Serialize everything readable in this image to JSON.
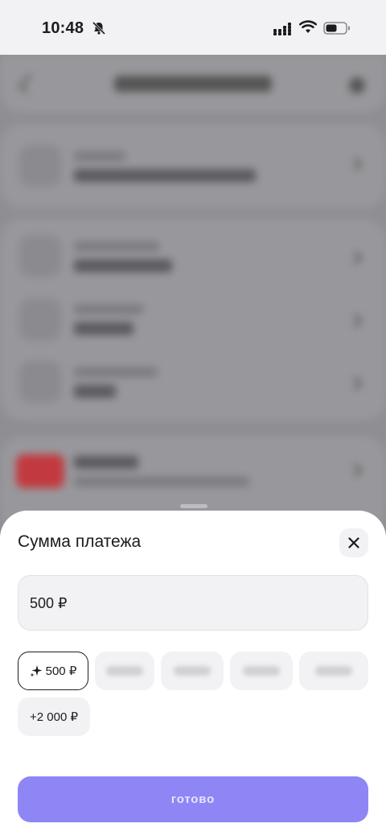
{
  "status_bar": {
    "time": "10:48"
  },
  "sheet": {
    "title": "Сумма платежа",
    "amount_value": "500 ₽",
    "suggestion_chips": [
      {
        "label": "500 ₽",
        "selected": true,
        "icon": "sparkle-icon"
      },
      {
        "label": "",
        "blurred": true
      },
      {
        "label": "",
        "blurred": true
      },
      {
        "label": "",
        "blurred": true
      },
      {
        "label": "",
        "blurred": true
      },
      {
        "label": "+2 000 ₽"
      }
    ],
    "done_label": "готово"
  },
  "colors": {
    "accent": "#8e86f5",
    "sheet_bg": "#ffffff",
    "field_bg": "#f2f2f5",
    "overlay_dim": "#8f8f93"
  }
}
